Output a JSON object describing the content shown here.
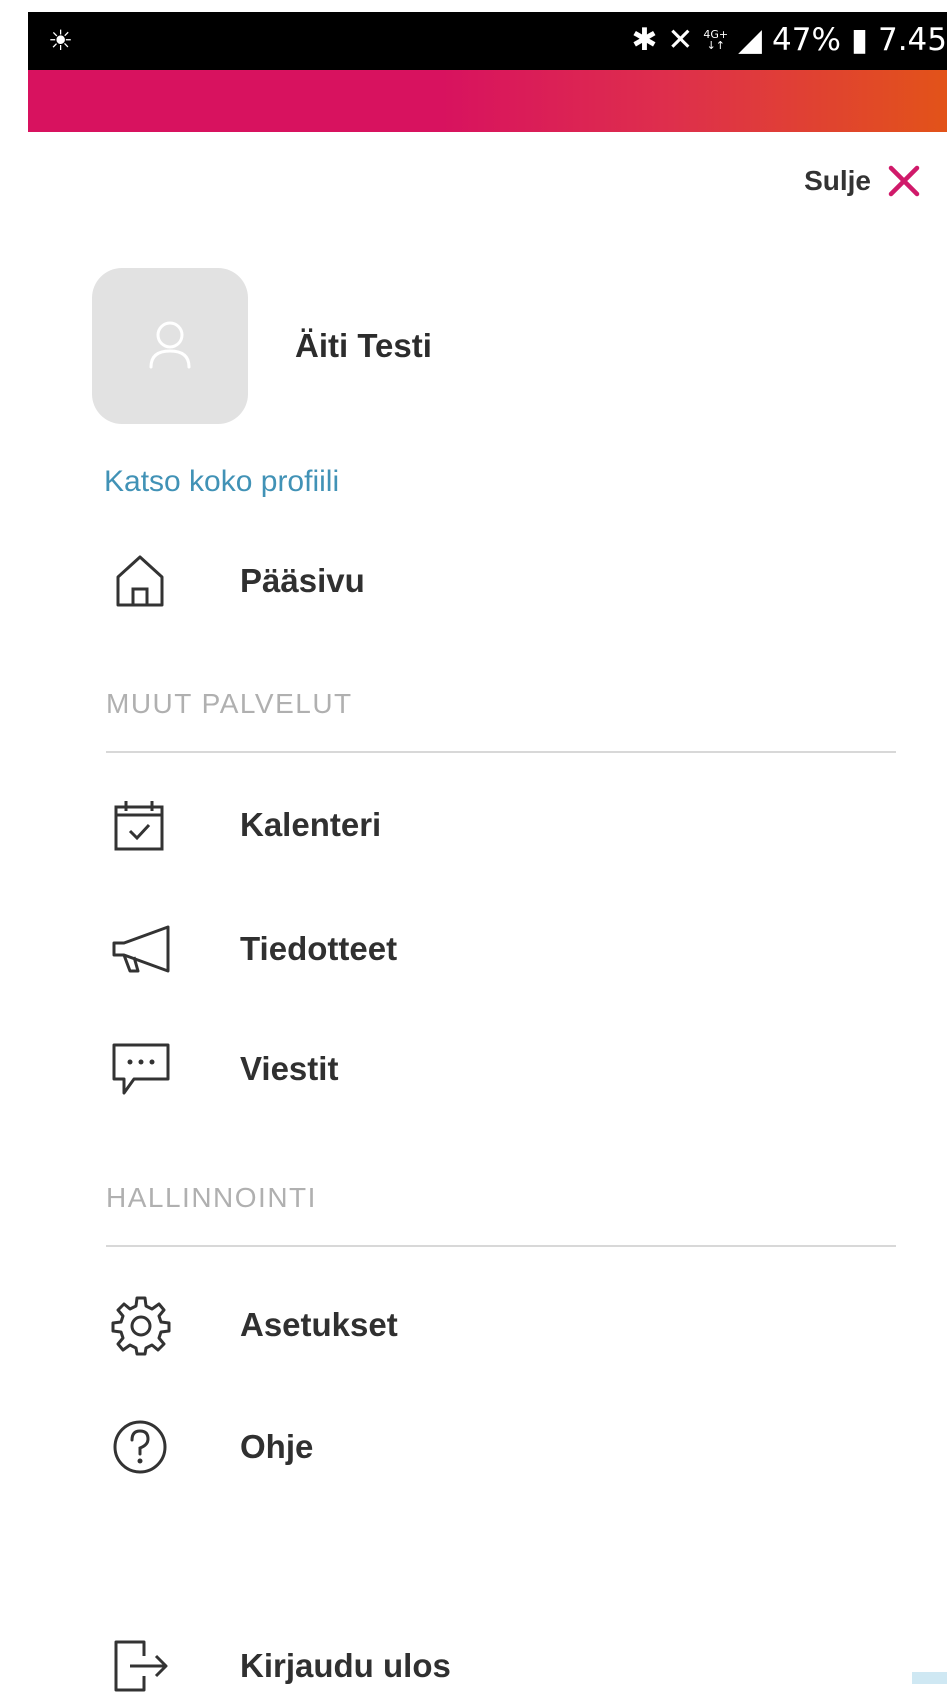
{
  "status_bar": {
    "left_icon": "cloud-sun-icon",
    "icons": [
      "bluetooth-icon",
      "mute-icon"
    ],
    "network_top": "4G+",
    "network_bottom": "↓↑",
    "battery_percent": "47%",
    "time": "7.45"
  },
  "header": {
    "gradient_colors": [
      "#d8125f",
      "#e25319"
    ],
    "close_label": "Sulje",
    "close_color": "#d01a6a"
  },
  "profile": {
    "name": "Äiti Testi",
    "link": "Katso koko profiili",
    "link_color": "#4192b6"
  },
  "menu": {
    "home": {
      "label": "Pääsivu",
      "icon": "home-icon"
    },
    "sections": [
      {
        "title": "MUUT PALVELUT",
        "items": [
          {
            "label": "Kalenteri",
            "icon": "calendar-check-icon"
          },
          {
            "label": "Tiedotteet",
            "icon": "megaphone-icon"
          },
          {
            "label": "Viestit",
            "icon": "message-icon"
          }
        ]
      },
      {
        "title": "HALLINNOINTI",
        "items": [
          {
            "label": "Asetukset",
            "icon": "gear-icon"
          },
          {
            "label": "Ohje",
            "icon": "help-icon"
          },
          {
            "label": "Kirjaudu ulos",
            "icon": "logout-icon"
          }
        ]
      }
    ]
  }
}
